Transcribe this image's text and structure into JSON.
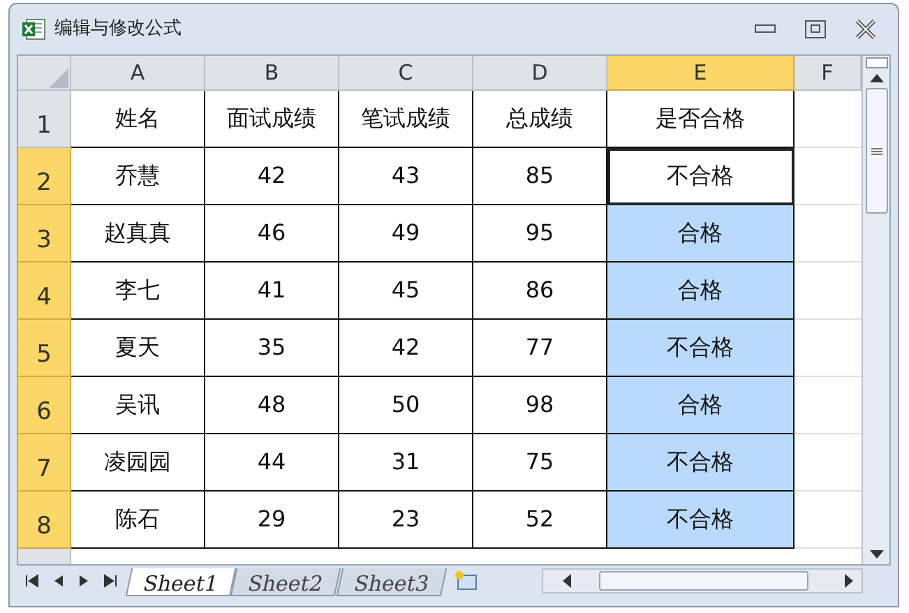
{
  "window": {
    "title": "编辑与修改公式"
  },
  "columns": [
    {
      "label": "A",
      "selected": false
    },
    {
      "label": "B",
      "selected": false
    },
    {
      "label": "C",
      "selected": false
    },
    {
      "label": "D",
      "selected": false
    },
    {
      "label": "E",
      "selected": true
    },
    {
      "label": "F",
      "selected": false
    }
  ],
  "rows": [
    {
      "header": "1",
      "selected": false,
      "cells": [
        {
          "text": "姓名",
          "selected": false,
          "active": false
        },
        {
          "text": "面试成绩",
          "selected": false,
          "active": false
        },
        {
          "text": "笔试成绩",
          "selected": false,
          "active": false
        },
        {
          "text": "总成绩",
          "selected": false,
          "active": false
        },
        {
          "text": "是否合格",
          "selected": false,
          "active": false
        }
      ]
    },
    {
      "header": "2",
      "selected": true,
      "cells": [
        {
          "text": "乔慧",
          "selected": false,
          "active": false
        },
        {
          "text": "42",
          "selected": false,
          "active": false
        },
        {
          "text": "43",
          "selected": false,
          "active": false
        },
        {
          "text": "85",
          "selected": false,
          "active": false
        },
        {
          "text": "不合格",
          "selected": true,
          "active": true
        }
      ]
    },
    {
      "header": "3",
      "selected": true,
      "cells": [
        {
          "text": "赵真真",
          "selected": false,
          "active": false
        },
        {
          "text": "46",
          "selected": false,
          "active": false
        },
        {
          "text": "49",
          "selected": false,
          "active": false
        },
        {
          "text": "95",
          "selected": false,
          "active": false
        },
        {
          "text": "合格",
          "selected": true,
          "active": false
        }
      ]
    },
    {
      "header": "4",
      "selected": true,
      "cells": [
        {
          "text": "李七",
          "selected": false,
          "active": false
        },
        {
          "text": "41",
          "selected": false,
          "active": false
        },
        {
          "text": "45",
          "selected": false,
          "active": false
        },
        {
          "text": "86",
          "selected": false,
          "active": false
        },
        {
          "text": "合格",
          "selected": true,
          "active": false
        }
      ]
    },
    {
      "header": "5",
      "selected": true,
      "cells": [
        {
          "text": "夏天",
          "selected": false,
          "active": false
        },
        {
          "text": "35",
          "selected": false,
          "active": false
        },
        {
          "text": "42",
          "selected": false,
          "active": false
        },
        {
          "text": "77",
          "selected": false,
          "active": false
        },
        {
          "text": "不合格",
          "selected": true,
          "active": false
        }
      ]
    },
    {
      "header": "6",
      "selected": true,
      "cells": [
        {
          "text": "吴讯",
          "selected": false,
          "active": false
        },
        {
          "text": "48",
          "selected": false,
          "active": false
        },
        {
          "text": "50",
          "selected": false,
          "active": false
        },
        {
          "text": "98",
          "selected": false,
          "active": false
        },
        {
          "text": "合格",
          "selected": true,
          "active": false
        }
      ]
    },
    {
      "header": "7",
      "selected": true,
      "cells": [
        {
          "text": "凌园园",
          "selected": false,
          "active": false
        },
        {
          "text": "44",
          "selected": false,
          "active": false
        },
        {
          "text": "31",
          "selected": false,
          "active": false
        },
        {
          "text": "75",
          "selected": false,
          "active": false
        },
        {
          "text": "不合格",
          "selected": true,
          "active": false
        }
      ]
    },
    {
      "header": "8",
      "selected": true,
      "cells": [
        {
          "text": "陈石",
          "selected": false,
          "active": false
        },
        {
          "text": "29",
          "selected": false,
          "active": false
        },
        {
          "text": "23",
          "selected": false,
          "active": false
        },
        {
          "text": "52",
          "selected": false,
          "active": false
        },
        {
          "text": "不合格",
          "selected": true,
          "active": false
        }
      ]
    }
  ],
  "sheet_tabs": [
    {
      "label": "Sheet1",
      "selected": true
    },
    {
      "label": "Sheet2",
      "selected": false
    },
    {
      "label": "Sheet3",
      "selected": false
    }
  ]
}
